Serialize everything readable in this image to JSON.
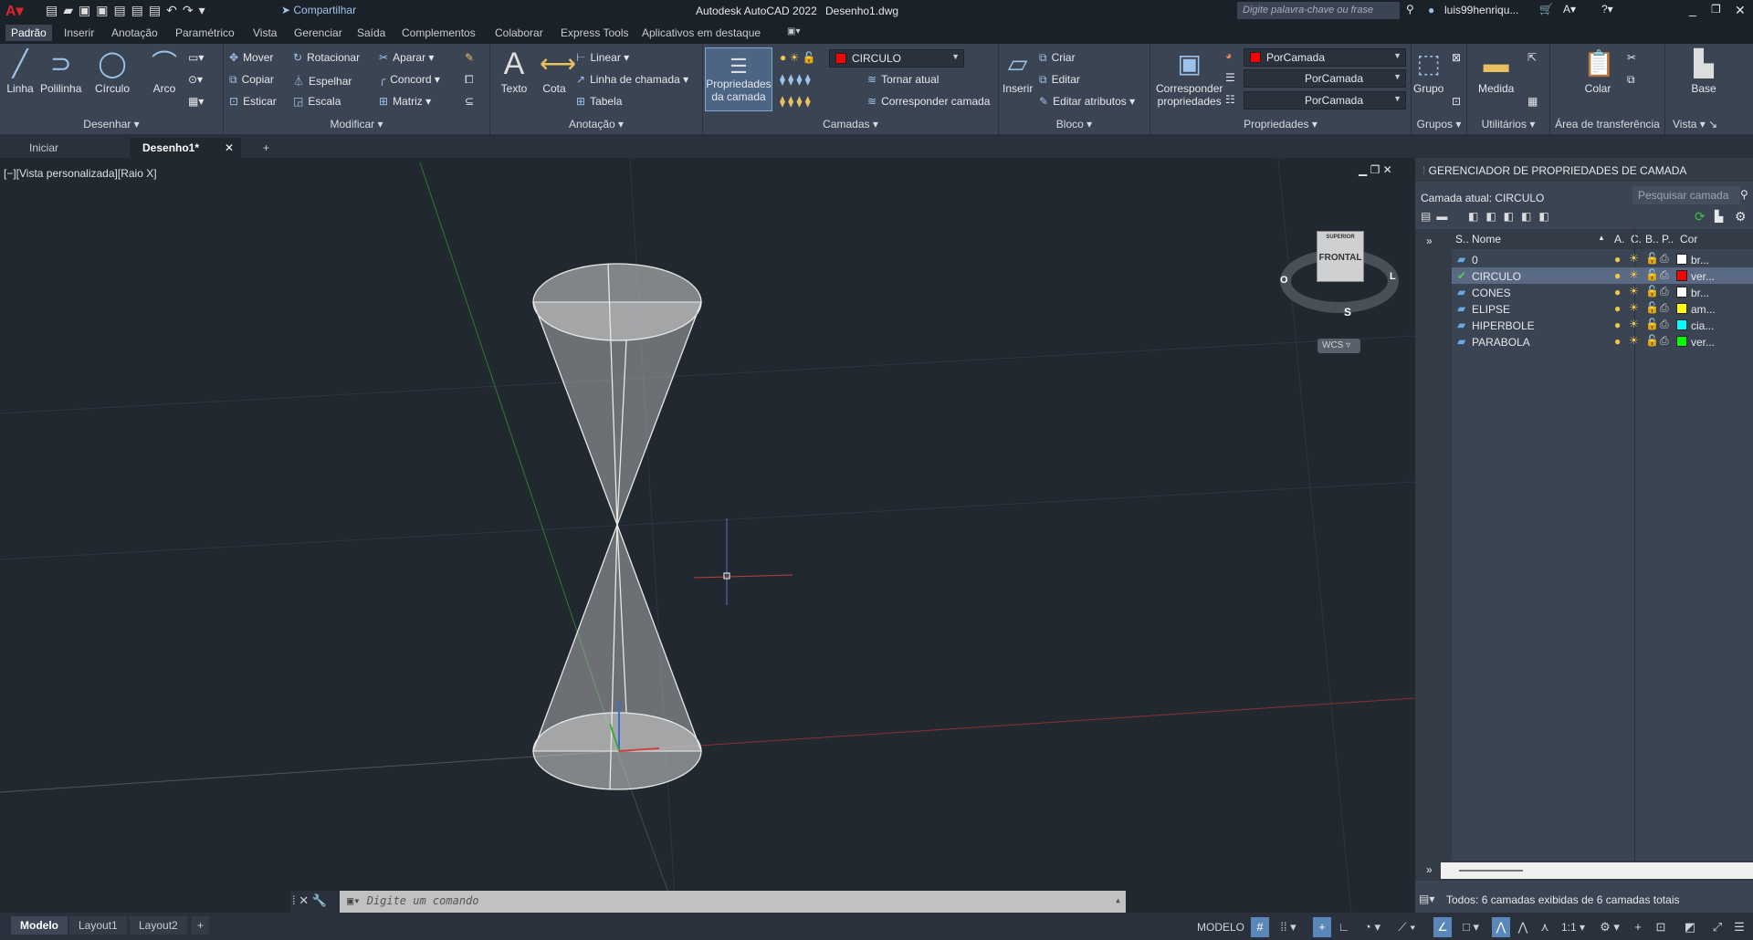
{
  "titlebar": {
    "app_title": "Autodesk AutoCAD 2022",
    "file": "Desenho1.dwg",
    "share": "Compartilhar",
    "search_placeholder": "Digite palavra-chave ou frase",
    "user": "luis99henriqu..."
  },
  "ribbon_tabs": [
    "Padrão",
    "Inserir",
    "Anotação",
    "Paramétrico",
    "Vista",
    "Gerenciar",
    "Saída",
    "Complementos",
    "Colaborar",
    "Express Tools",
    "Aplicativos em destaque"
  ],
  "panels": {
    "desenhar": {
      "label": "Desenhar",
      "linha": "Linha",
      "polilinha": "Polilinha",
      "circulo": "Círculo",
      "arco": "Arco"
    },
    "modificar": {
      "label": "Modificar",
      "mover": "Mover",
      "rotacionar": "Rotacionar",
      "aparar": "Aparar",
      "copiar": "Copiar",
      "espelhar": "Espelhar",
      "concord": "Concord",
      "esticar": "Esticar",
      "escala": "Escala",
      "matriz": "Matriz"
    },
    "anotacao": {
      "label": "Anotação",
      "texto": "Texto",
      "cota": "Cota",
      "linear": "Linear",
      "linha_chamada": "Linha de chamada",
      "tabela": "Tabela"
    },
    "camadas": {
      "label": "Camadas",
      "prop1": "Propriedades",
      "prop2": "da camada",
      "current": "CIRCULO",
      "tornar_atual": "Tornar atual",
      "corresponder": "Corresponder camada"
    },
    "bloco": {
      "label": "Bloco",
      "inserir": "Inserir",
      "criar": "Criar",
      "editar": "Editar",
      "editar_atributos": "Editar atributos"
    },
    "propriedades": {
      "label": "Propriedades",
      "corr1": "Corresponder",
      "corr2": "propriedades",
      "color": "PorCamada",
      "linetype": "PorCamada",
      "lineweight": "PorCamada"
    },
    "grupos": {
      "label": "Grupos",
      "grupo": "Grupo"
    },
    "utilitarios": {
      "label": "Utilitários",
      "medida": "Medida"
    },
    "area": {
      "label": "Área de transferência",
      "colar": "Colar"
    },
    "vista": {
      "label": "Vista",
      "base": "Base"
    }
  },
  "file_tabs": {
    "iniciar": "Iniciar",
    "desenho": "Desenho1*"
  },
  "viewport": {
    "label": "[−][Vista personalizada][Raio X]",
    "viewcube_top": "SUPERIOR",
    "viewcube_front": "FRONTAL",
    "compass_w": "O",
    "compass_e": "L",
    "compass_s": "S",
    "wcs": "WCS"
  },
  "command": {
    "placeholder": "Digite um comando"
  },
  "layout_tabs": [
    "Modelo",
    "Layout1",
    "Layout2"
  ],
  "layer_panel": {
    "title": "GERENCIADOR DE PROPRIEDADES DE CAMADA",
    "current": "Camada atual: CIRCULO",
    "search_placeholder": "Pesquisar camada",
    "headers": {
      "s": "S..",
      "nome": "Nome",
      "a": "A.",
      "c": "C.",
      "b": "B..",
      "p": "P..",
      "cor": "Cor"
    },
    "layers": [
      {
        "name": "0",
        "color_name": "br...",
        "color": "#ffffff",
        "current": false
      },
      {
        "name": "CIRCULO",
        "color_name": "ver...",
        "color": "#ff0000",
        "current": true
      },
      {
        "name": "CONES",
        "color_name": "br...",
        "color": "#ffffff",
        "current": false
      },
      {
        "name": "ELIPSE",
        "color_name": "am...",
        "color": "#ffff00",
        "current": false
      },
      {
        "name": "HIPERBOLE",
        "color_name": "cia...",
        "color": "#00ffff",
        "current": false
      },
      {
        "name": "PARABOLA",
        "color_name": "ver...",
        "color": "#00ff00",
        "current": false
      }
    ],
    "status": "Todos: 6 camadas exibidas de 6 camadas totais"
  },
  "statusbar": {
    "modelo": "MODELO",
    "scale": "1:1"
  }
}
